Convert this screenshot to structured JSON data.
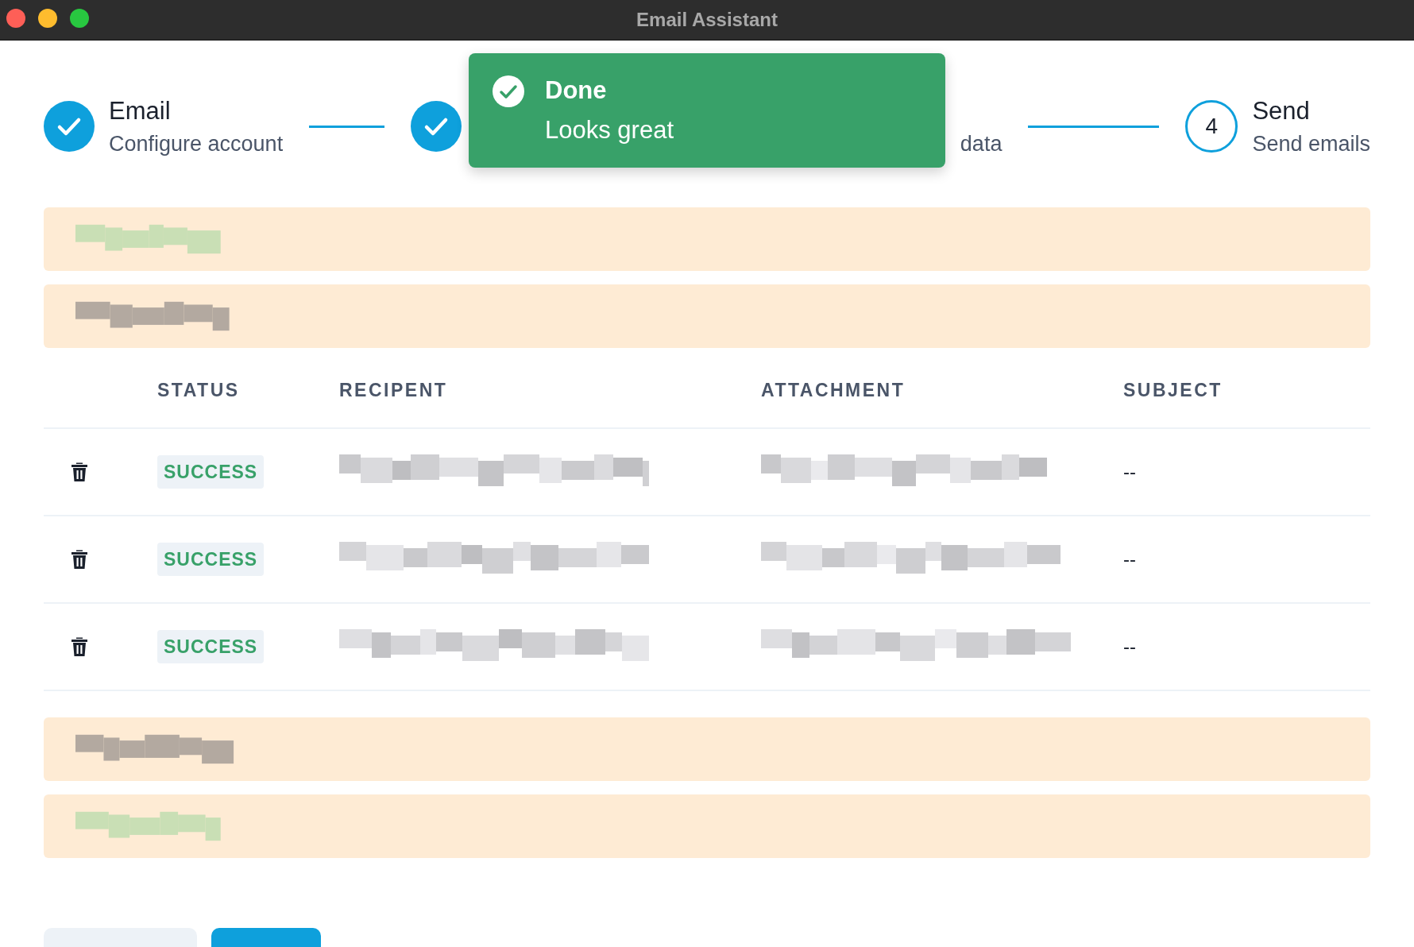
{
  "window": {
    "title": "Email Assistant"
  },
  "steps": [
    {
      "kind": "check",
      "title": "Email",
      "description": "Configure account"
    },
    {
      "kind": "check"
    },
    {
      "kind": "covered",
      "description": "data"
    },
    {
      "kind": "number",
      "number": "4",
      "title": "Send",
      "description": "Send emails"
    }
  ],
  "toast": {
    "kind": "success",
    "title": "Done",
    "message": "Looks great"
  },
  "top_notices": [
    {
      "kind": "redacted"
    },
    {
      "kind": "redacted"
    }
  ],
  "table": {
    "columns": [
      "STATUS",
      "RECIPENT",
      "ATTACHMENT",
      "SUBJECT"
    ],
    "rows": [
      {
        "status": "SUCCESS",
        "recipient": {
          "kind": "redacted"
        },
        "attachment": {
          "kind": "redacted"
        },
        "subject": "--"
      },
      {
        "status": "SUCCESS",
        "recipient": {
          "kind": "redacted"
        },
        "attachment": {
          "kind": "redacted"
        },
        "subject": "--"
      },
      {
        "status": "SUCCESS",
        "recipient": {
          "kind": "redacted"
        },
        "attachment": {
          "kind": "redacted"
        },
        "subject": "--"
      }
    ]
  },
  "bottom_notices": [
    {
      "kind": "redacted"
    },
    {
      "kind": "redacted"
    }
  ],
  "buttons": [
    {
      "kind": "secondary"
    },
    {
      "kind": "primary"
    }
  ]
}
